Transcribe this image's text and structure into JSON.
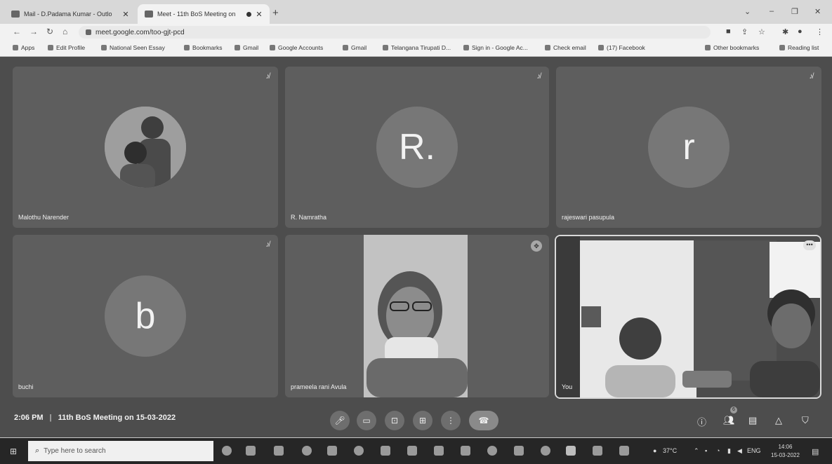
{
  "browser": {
    "tabs": [
      {
        "title": "Mail - D.Padama Kumar - Outlo",
        "active": false
      },
      {
        "title": "Meet - 11th BoS Meeting on",
        "active": true
      }
    ],
    "url": "meet.google.com/too-gjt-pcd",
    "bookmarks": [
      "Apps",
      "Edit Profile",
      "National Seen Essay",
      "Bookmarks",
      "Gmail",
      "Google Accounts",
      "Gmail",
      "Telangana Tirupati D...",
      "Sign in - Google Ac...",
      "Check email",
      "(17) Facebook",
      "Other bookmarks",
      "Reading list"
    ]
  },
  "participants": [
    {
      "name": "Malothu Narender",
      "initial": "",
      "type": "photo"
    },
    {
      "name": "R. Namratha",
      "initial": "R.",
      "type": "initial"
    },
    {
      "name": "rajeswari pasupula",
      "initial": "r",
      "type": "initial"
    },
    {
      "name": "buchi",
      "initial": "b",
      "type": "initial"
    },
    {
      "name": "prameela rani Avula",
      "initial": "",
      "type": "video"
    },
    {
      "name": "You",
      "initial": "",
      "type": "video"
    }
  ],
  "meeting": {
    "time": "2:06 PM",
    "separator": "|",
    "title": "11th BoS Meeting on 15-03-2022",
    "people_count": "6"
  },
  "taskbar": {
    "search_placeholder": "Type here to search",
    "weather": "37°C",
    "lang": "ENG",
    "clock_time": "14:06",
    "clock_date": "15-03-2022"
  },
  "colors": {
    "stage": "#4d4d4d",
    "tile": "#5e5e5e",
    "avatar": "#777777",
    "end_call": "#8a8a8a"
  }
}
